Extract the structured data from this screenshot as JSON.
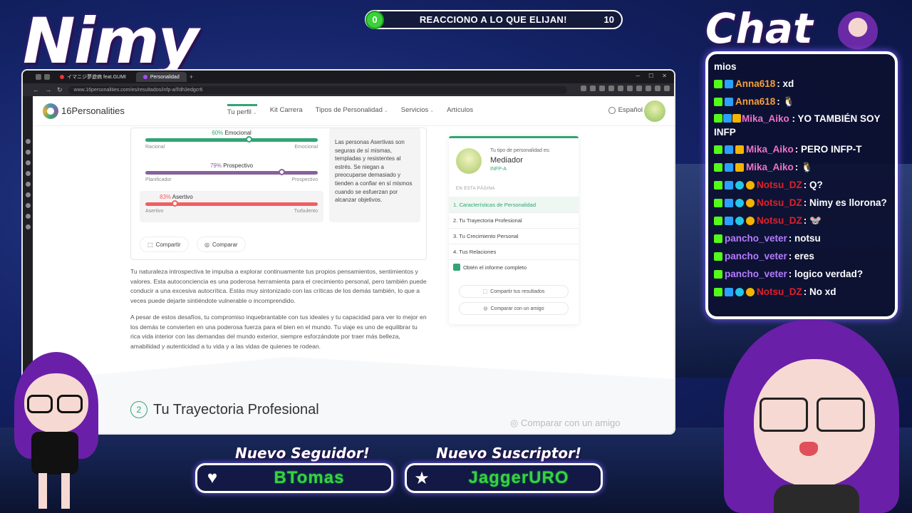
{
  "overlay": {
    "streamer_name": "Nimy",
    "chat_title": "Chat",
    "goal": {
      "current": "0",
      "title": "REACCIONO A LO QUE ELIJAN!",
      "max": "10"
    },
    "alerts": {
      "follower_title": "Nuevo Seguidor!",
      "follower_name": "BTomas",
      "subscriber_title": "Nuevo Suscriptor!",
      "subscriber_name": "JaggerURO"
    }
  },
  "browser": {
    "tabs": [
      {
        "label": "イマニジ夢遊病 feat.GUMI"
      },
      {
        "label": "Personalidad"
      }
    ],
    "tab_plus": "+",
    "url": "www.16personalities.com/es/resultados/infp-a/f/dh3edgcr6"
  },
  "site": {
    "logo": "16Personalities",
    "nav": [
      {
        "label": "Tu perfil",
        "caret": "⌄"
      },
      {
        "label": "Kit Carrera",
        "caret": ""
      },
      {
        "label": "Tipos de Personalidad",
        "caret": "⌄"
      },
      {
        "label": "Servicios",
        "caret": "⌄"
      },
      {
        "label": "Artículos",
        "caret": ""
      }
    ],
    "language": "Español"
  },
  "traits": [
    {
      "percent": "60%",
      "name": "Emocional",
      "left": "Racional",
      "right": "Emocional",
      "color": "#33a474",
      "value": 0.6
    },
    {
      "percent": "79%",
      "name": "Prospectivo",
      "left": "Planificador",
      "right": "Prospectivo",
      "color": "#88619a",
      "value": 0.79
    },
    {
      "percent": "83%",
      "name": "Asertivo",
      "left": "Asertivo",
      "right": "Turbulento",
      "color": "#f25e62",
      "value": 0.17
    }
  ],
  "trait_description": "Las personas Asertivas son seguras de sí mismas, templadas y resistentes al estrés. Se niegan a preocuparse demasiado y tienden a confiar en sí mismos cuando se esfuerzan por alcanzar objetivos.",
  "card_buttons": {
    "share": "Compartir",
    "compare": "Comparar"
  },
  "paragraphs": [
    "Tu naturaleza introspectiva te impulsa a explorar continuamente tus propios pensamientos, sentimientos y valores. Esta autoconciencia es una poderosa herramienta para el crecimiento personal, pero también puede conducir a una excesiva autocrítica. Estás muy sintonizado con las críticas de los demás también, lo que a veces puede dejarte sintiéndote vulnerable o incomprendido.",
    "A pesar de estos desafíos, tu compromiso inquebrantable con tus ideales y tu capacidad para ver lo mejor en los demás te convierten en una poderosa fuerza para el bien en el mundo. Tu viaje es uno de equilibrar tu rica vida interior con las demandas del mundo exterior, siempre esforzándote por traer más belleza, amabilidad y autenticidad a tu vida y a las vidas de quienes te rodean."
  ],
  "side_card": {
    "label": "Tu tipo de personalidad es:",
    "type": "Mediador",
    "code": "INFP-A",
    "on_page": "EN ESTA PÁGINA",
    "items": [
      "1. Características de Personalidad",
      "2. Tu Trayectoria Profesional",
      "3. Tu Crecimiento Personal",
      "4. Tus Relaciones"
    ],
    "report": "Obtén el informe completo",
    "share_results": "Compartir tus resultados",
    "compare_friend": "Comparar con un amigo"
  },
  "section": {
    "number": "2",
    "title": "Tu Trayectoria Profesional"
  },
  "faded_button": "Comparar con un amigo",
  "chat": [
    {
      "wrap": true,
      "badges": [],
      "user": "",
      "text": "mios",
      "user_class": ""
    },
    {
      "badges": [
        "k",
        "s"
      ],
      "user": "Anna618",
      "text": ": xd",
      "user_class": "u-anna"
    },
    {
      "badges": [
        "k",
        "s"
      ],
      "user": "Anna618",
      "text": ": 🐧",
      "user_class": "u-anna"
    },
    {
      "wrap": true,
      "badges": [
        "k",
        "s",
        "c"
      ],
      "user": "Mika_Aiko",
      "text": ": YO TAMBIÉN SOY INFP",
      "user_class": "u-mika"
    },
    {
      "badges": [
        "k",
        "s",
        "c"
      ],
      "user": "Mika_Aiko",
      "text": ": PERO INFP-T",
      "user_class": "u-mika"
    },
    {
      "badges": [
        "k",
        "s",
        "c"
      ],
      "user": "Mika_Aiko",
      "text": ": 🐧",
      "user_class": "u-mika"
    },
    {
      "badges": [
        "k",
        "s",
        "g",
        "1"
      ],
      "user": "Notsu_DZ",
      "text": ": Q?",
      "user_class": "u-notsu"
    },
    {
      "badges": [
        "k",
        "s",
        "g",
        "1"
      ],
      "user": "Notsu_DZ",
      "text": ": Nimy es llorona?",
      "user_class": "u-notsu"
    },
    {
      "badges": [
        "k",
        "s",
        "g",
        "1"
      ],
      "user": "Notsu_DZ",
      "text": ": 🐭",
      "user_class": "u-notsu"
    },
    {
      "badges": [
        "k"
      ],
      "user": "pancho_veter",
      "text": ": notsu",
      "user_class": "u-pancho"
    },
    {
      "badges": [
        "k"
      ],
      "user": "pancho_veter",
      "text": ": eres",
      "user_class": "u-pancho"
    },
    {
      "badges": [
        "k"
      ],
      "user": "pancho_veter",
      "text": ": logico verdad?",
      "user_class": "u-pancho"
    },
    {
      "badges": [
        "k",
        "s",
        "g",
        "1"
      ],
      "user": "Notsu_DZ",
      "text": ": No xd",
      "user_class": "u-notsu"
    }
  ],
  "icons": {
    "heart": "heart-icon",
    "star": "star-icon",
    "globe": "globe-icon"
  },
  "colors": {
    "accent_green": "#33a474",
    "goal_green": "#3bd13b",
    "chat_border": "#ffffff"
  }
}
